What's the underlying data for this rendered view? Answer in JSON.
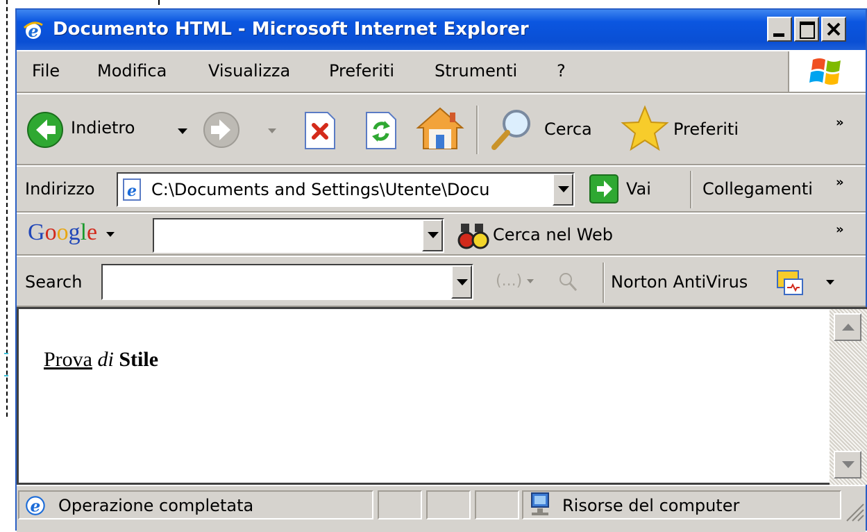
{
  "window": {
    "title": "Documento HTML - Microsoft Internet Explorer",
    "controls": [
      "minimize-button",
      "maximize-button",
      "close-button"
    ]
  },
  "menubar": {
    "items": [
      {
        "label": "File"
      },
      {
        "label": "Modifica"
      },
      {
        "label": "Visualizza"
      },
      {
        "label": "Preferiti"
      },
      {
        "label": "Strumenti"
      },
      {
        "label": "?"
      }
    ]
  },
  "toolbar": {
    "back_label": "Indietro",
    "search_label": "Cerca",
    "favorites_label": "Preferiti",
    "more_glyph": "»"
  },
  "addressbar": {
    "label": "Indirizzo",
    "value": "C:\\Documents and Settings\\Utente\\Docu",
    "go_label": "Vai",
    "links_label": "Collegamenti",
    "more_glyph": "»"
  },
  "googlebar": {
    "logo": "Google",
    "query": "",
    "search_web_label": "Cerca nel Web",
    "more_glyph": "»"
  },
  "searchbar": {
    "label": "Search",
    "query": "",
    "norton_label": "Norton AntiVirus"
  },
  "content": {
    "text_underline": "Prova",
    "text_italic": "di",
    "text_bold": "Stile"
  },
  "statusbar": {
    "status": "Operazione completata",
    "zone": "Risorse del computer"
  },
  "colors": {
    "titlebar": "#0a54dc",
    "chrome": "#d6d3ce",
    "back_arrow": "#2fa832",
    "stop": "#d42a1a",
    "favorites_star": "#f7cc2b"
  }
}
